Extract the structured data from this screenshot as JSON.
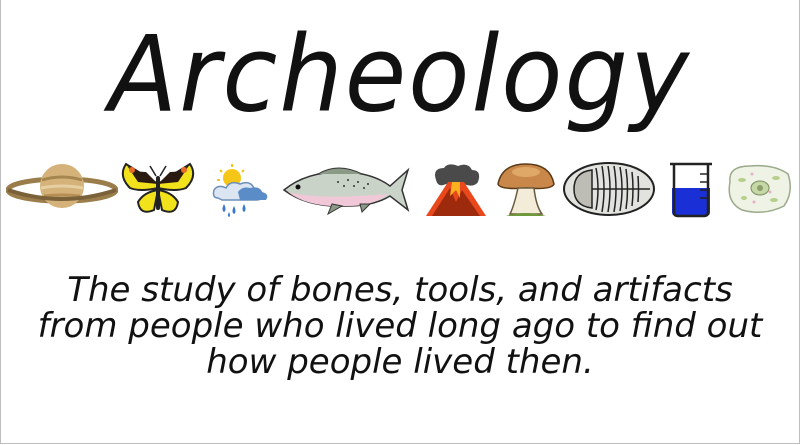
{
  "page": {
    "title": "Archeology",
    "description_lines": [
      "The study of bones, tools, and artifacts",
      "from people who lived long ago to find out",
      "how people lived then."
    ]
  },
  "icons": [
    "saturn-icon",
    "butterfly-icon",
    "weather-icon",
    "fish-icon",
    "volcano-icon",
    "mushroom-icon",
    "trilobite-fossil-icon",
    "beaker-icon",
    "cell-icon"
  ],
  "colors": {
    "text": "#111111",
    "beaker_liquid": "#1a2fd6",
    "butterfly_yellow": "#f2e21c",
    "volcano_lava": "#e8481c"
  }
}
